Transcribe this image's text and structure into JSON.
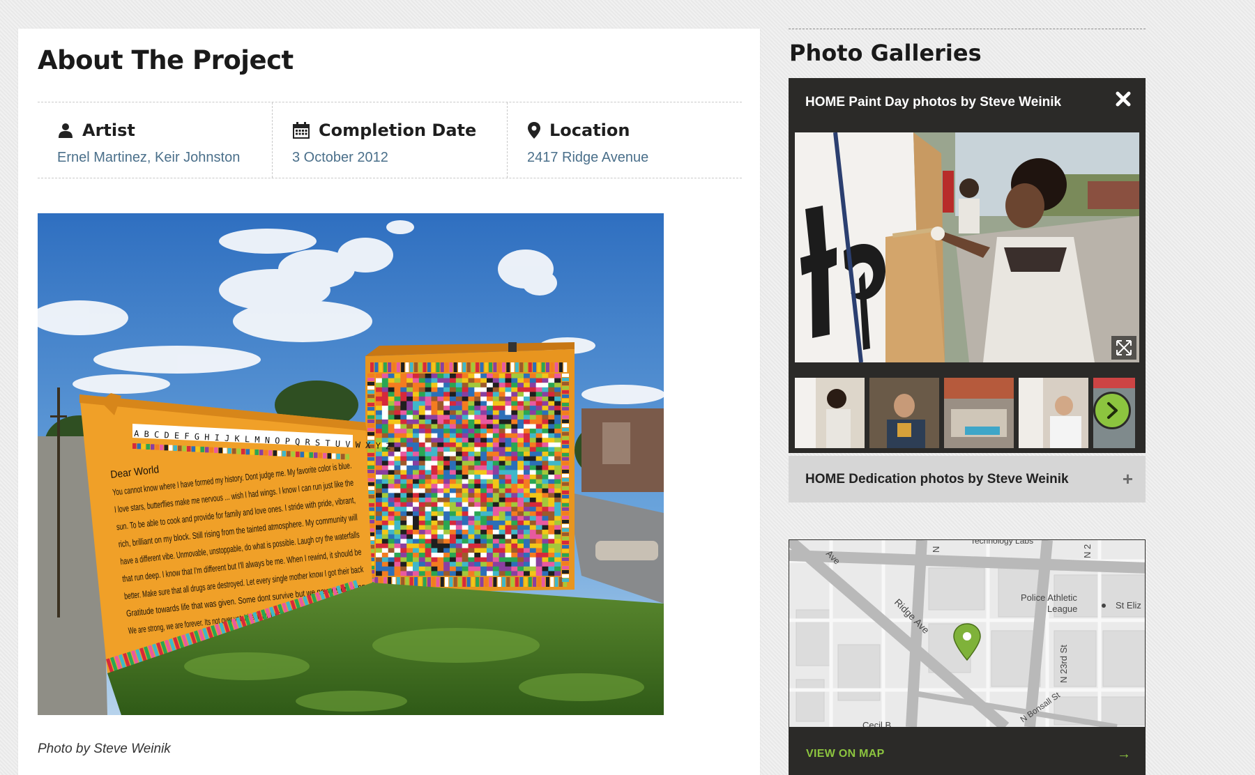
{
  "project": {
    "title": "About The Project",
    "artist_label": "Artist",
    "artist_value": "Ernel Martinez, Keir Johnston",
    "date_label": "Completion Date",
    "date_value": "3 October 2012",
    "location_label": "Location",
    "location_value": "2417 Ridge Avenue",
    "photo_caption": "Photo by Steve Weinik"
  },
  "mural": {
    "alphabet": "A B C D E F G H I J K L M N O P Q R S T U V W X Y Z",
    "poem_lines": [
      "Dear World",
      "You cannot know where I have formed my history. Dont judge me. My favorite color is blue.",
      "I love stars, butterflies make me nervous ... wish I had wings. I know I can run just like the",
      "sun. To be able to cook and provide for family and love ones. I stride with pride, vibrant,",
      "rich, brilliant on my block.  Still rising from the tainted atmosphere. My community will",
      "have a different vibe. Unmovable, unstoppable, do what is possible. Laugh cry the waterfalls",
      "that run deep. I know  that I'm different but I'll always be me. When I rewind, it should be",
      "better. Make sure that all drugs are destroyed. Let every single mother know I got their back",
      "Gratitude towards life that was given. Some dont survive but we never stop living",
      "We are strong, we are forever. Its not over yet.  Live in full technicolor... going to fit where I belong"
    ]
  },
  "sidebar": {
    "heading": "Photo Galleries",
    "gallery_open_title": "HOME Paint Day photos by Steve Weinik",
    "gallery_collapsed_title": "HOME Dedication photos by Steve Weinik",
    "plus_symbol": "+",
    "map_footer_label": "VIEW ON MAP",
    "map_footer_arrow": "→"
  },
  "map": {
    "labels": {
      "tech_labs": "Technology Labs",
      "ridge_ave": "Ridge Ave",
      "ridge_ave_top": "Ave",
      "police_1": "Police Athletic",
      "police_2": "League",
      "st_eliz": "St Eliz",
      "n_23rd": "N 23rd St",
      "n_bonsall": "N Bonsall St",
      "n2_a": "N 2",
      "n_b": "N",
      "cecil": "Cecil B"
    }
  },
  "colors": {
    "accent_green": "#8cc43f",
    "panel_dark": "#2b2a28",
    "link_blue": "#4a6f8a",
    "mural_orange": "#e8951f"
  },
  "icons": {
    "artist": "user-icon",
    "date": "calendar-icon",
    "location": "map-pin-icon",
    "close": "close-icon",
    "expand": "expand-icon",
    "next": "chevron-right-icon",
    "map_marker": "map-marker-icon"
  }
}
